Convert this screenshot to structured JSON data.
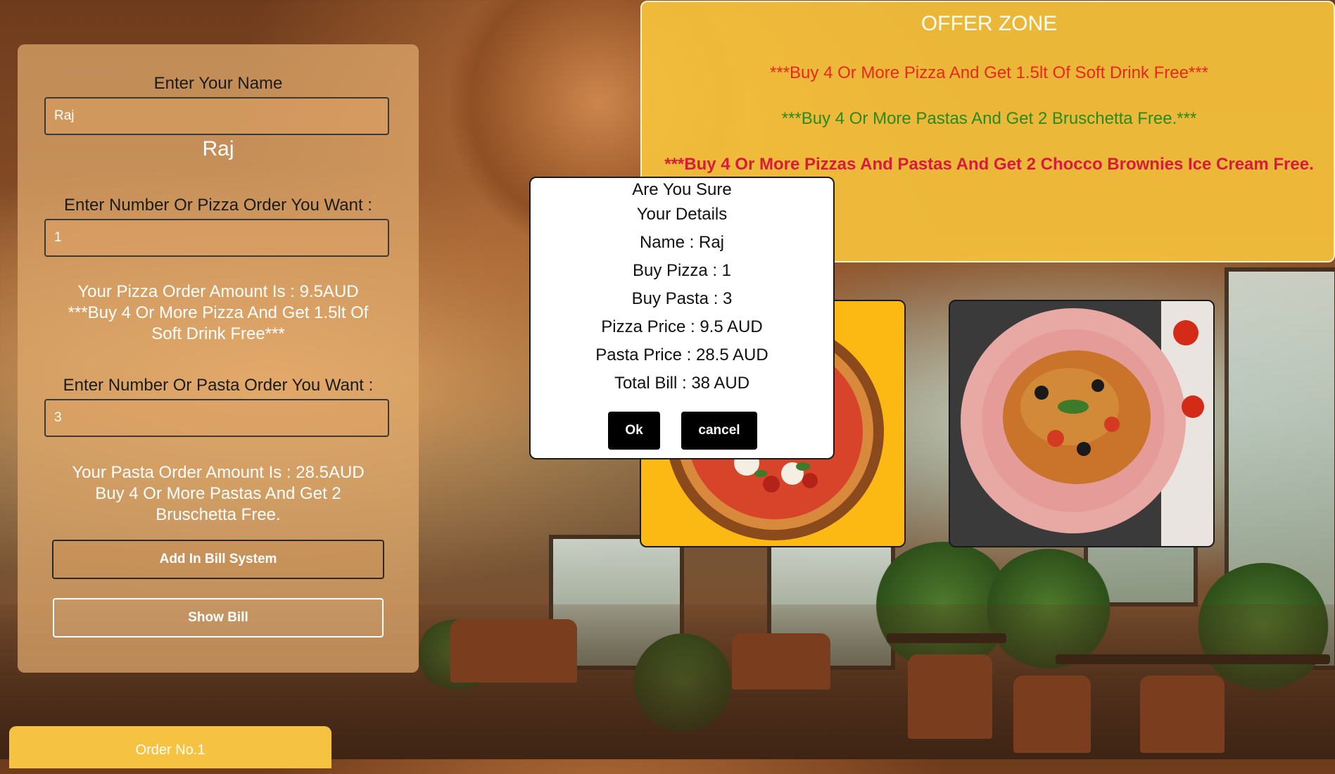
{
  "form": {
    "name_label": "Enter Your Name",
    "name_value": "Raj",
    "name_echo": "Raj",
    "pizza_label": "Enter Number Or Pizza Order You Want :",
    "pizza_value": "1",
    "pizza_amount": "Your Pizza Order Amount Is : 9.5AUD",
    "pizza_offer": "***Buy 4 Or More Pizza And Get 1.5lt Of Soft Drink Free***",
    "pasta_label": "Enter Number Or Pasta Order You Want :",
    "pasta_value": "3",
    "pasta_amount": "Your Pasta Order Amount Is : 28.5AUD",
    "pasta_offer": "Buy 4 Or More Pastas And Get 2 Bruschetta Free.",
    "add_button": "Add In Bill System",
    "show_button": "Show Bill"
  },
  "order_tab": "Order No.1",
  "offer_zone": {
    "title": "OFFER ZONE",
    "offers": [
      {
        "text": "***Buy 4 Or More Pizza And Get 1.5lt Of Soft Drink Free***",
        "color": "#e8281e"
      },
      {
        "text": "***Buy 4 Or More Pastas And Get 2 Bruschetta Free.***",
        "color": "#2a8a1e"
      },
      {
        "text": "***Buy 4 Or More Pizzas And Pastas And Get 2 Chocco Brownies Ice Cream Free.",
        "color": "#d81b3c"
      }
    ]
  },
  "dialog": {
    "title": "Are You Sure",
    "subtitle": "Your Details",
    "name": "Name : Raj",
    "buy_pizza": "Buy Pizza : 1",
    "buy_pasta": "Buy Pasta : 3",
    "pizza_price": "Pizza Price : 9.5 AUD",
    "pasta_price": "Pasta Price : 28.5 AUD",
    "total": "Total Bill : 38 AUD",
    "ok": "Ok",
    "cancel": "cancel"
  }
}
